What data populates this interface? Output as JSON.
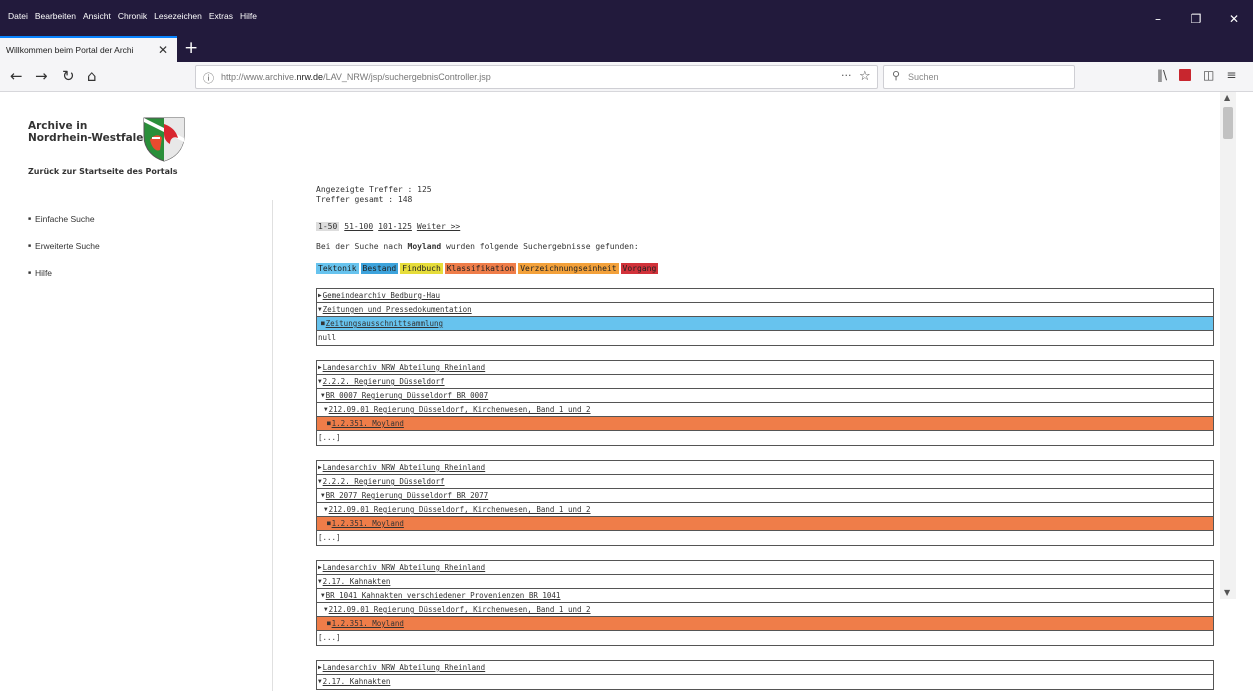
{
  "browser": {
    "menu": [
      "Datei",
      "Bearbeiten",
      "Ansicht",
      "Chronik",
      "Lesezeichen",
      "Extras",
      "Hilfe"
    ],
    "tab_title": "Willkommen beim Portal der Archi",
    "url_prefix": "http://www.archive.",
    "url_domain": "nrw.de",
    "url_path": "/LAV_NRW/jsp/suchergebnisController.jsp",
    "search_placeholder": "Suchen",
    "icons": {
      "back": "←",
      "forward": "→",
      "reload": "↻",
      "home": "⌂",
      "info": "ⓘ",
      "more": "···",
      "star": "☆",
      "search": "⚲",
      "library": "‖\\",
      "sidebar": "◫",
      "menu": "≡",
      "minimize": "–",
      "maximize": "❐",
      "close": "✕",
      "new_tab": "+",
      "tab_close": "✕"
    }
  },
  "sidebar": {
    "logo_line1": "Archive in",
    "logo_line2": "Nordrhein-Westfalen",
    "home_link": "Zurück zur Startseite des Portals",
    "items": [
      "Einfache Suche",
      "Erweiterte Suche",
      "Hilfe"
    ]
  },
  "results": {
    "shown": "Angezeigte Treffer : 125",
    "total": "Treffer gesamt : 148",
    "pager": {
      "current": "1-50",
      "pages": [
        "51-100",
        "101-125"
      ],
      "next": "Weiter >>"
    },
    "intro_before": "Bei der Suche nach ",
    "intro_term": "Moyland",
    "intro_after": " wurden folgende Suchergebnisse gefunden:",
    "legend": [
      {
        "label": "Tektonik",
        "color": "#67c3ee"
      },
      {
        "label": "Bestand",
        "color": "#3da3dc"
      },
      {
        "label": "Findbuch",
        "color": "#e6dd3a"
      },
      {
        "label": "Klassifikation",
        "color": "#ef7d49"
      },
      {
        "label": "Verzeichnungseinheit",
        "color": "#f3a13a"
      },
      {
        "label": "Vorgang",
        "color": "#d2323a"
      }
    ],
    "groups": [
      {
        "rows": [
          {
            "text": "Gemeindearchiv Bedburg-Hau",
            "marker": "▶",
            "indent": 0,
            "hl": "",
            "link": true
          },
          {
            "text": "Zeitungen und Pressedokumentation",
            "marker": "▼",
            "indent": 0,
            "hl": "",
            "link": true
          },
          {
            "text": "Zeitungsausschnittsammlung",
            "marker": "■",
            "indent": 3,
            "hl": "hl-blue",
            "link": true
          },
          {
            "text": "null",
            "marker": "",
            "indent": 0,
            "hl": "",
            "link": false
          }
        ]
      },
      {
        "rows": [
          {
            "text": "Landesarchiv NRW Abteilung Rheinland",
            "marker": "▶",
            "indent": 0,
            "hl": "",
            "link": true
          },
          {
            "text": "2.2.2. Regierung Düsseldorf",
            "marker": "▼",
            "indent": 0,
            "hl": "",
            "link": true
          },
          {
            "text": "BR 0007 Regierung Düsseldorf BR 0007",
            "marker": "▼",
            "indent": 3,
            "hl": "",
            "link": true
          },
          {
            "text": "212.09.01 Regierung Düsseldorf, Kirchenwesen, Band 1 und 2",
            "marker": "▼",
            "indent": 6,
            "hl": "",
            "link": true
          },
          {
            "text": "1.2.351. Moyland",
            "marker": "■",
            "indent": 9,
            "hl": "hl-orange",
            "link": true
          },
          {
            "text": "[...]",
            "marker": "",
            "indent": 0,
            "hl": "",
            "link": false
          }
        ]
      },
      {
        "rows": [
          {
            "text": "Landesarchiv NRW Abteilung Rheinland",
            "marker": "▶",
            "indent": 0,
            "hl": "",
            "link": true
          },
          {
            "text": "2.2.2. Regierung Düsseldorf",
            "marker": "▼",
            "indent": 0,
            "hl": "",
            "link": true
          },
          {
            "text": "BR 2077 Regierung Düsseldorf BR 2077",
            "marker": "▼",
            "indent": 3,
            "hl": "",
            "link": true
          },
          {
            "text": "212.09.01 Regierung Düsseldorf, Kirchenwesen, Band 1 und 2",
            "marker": "▼",
            "indent": 6,
            "hl": "",
            "link": true
          },
          {
            "text": "1.2.351. Moyland",
            "marker": "■",
            "indent": 9,
            "hl": "hl-orange",
            "link": true
          },
          {
            "text": "[...]",
            "marker": "",
            "indent": 0,
            "hl": "",
            "link": false
          }
        ]
      },
      {
        "rows": [
          {
            "text": "Landesarchiv NRW Abteilung Rheinland",
            "marker": "▶",
            "indent": 0,
            "hl": "",
            "link": true
          },
          {
            "text": "2.17. Kahnakten",
            "marker": "▼",
            "indent": 0,
            "hl": "",
            "link": true
          },
          {
            "text": "BR 1041 Kahnakten verschiedener Provenienzen BR 1041",
            "marker": "▼",
            "indent": 3,
            "hl": "",
            "link": true
          },
          {
            "text": "212.09.01 Regierung Düsseldorf, Kirchenwesen, Band 1 und 2",
            "marker": "▼",
            "indent": 6,
            "hl": "",
            "link": true
          },
          {
            "text": "1.2.351. Moyland",
            "marker": "■",
            "indent": 9,
            "hl": "hl-orange",
            "link": true
          },
          {
            "text": "[...]",
            "marker": "",
            "indent": 0,
            "hl": "",
            "link": false
          }
        ]
      },
      {
        "rows": [
          {
            "text": "Landesarchiv NRW Abteilung Rheinland",
            "marker": "▶",
            "indent": 0,
            "hl": "",
            "link": true
          },
          {
            "text": "2.17. Kahnakten",
            "marker": "▼",
            "indent": 0,
            "hl": "",
            "link": true
          }
        ]
      }
    ]
  },
  "scroll": {
    "up": "▲",
    "down": "▼"
  }
}
